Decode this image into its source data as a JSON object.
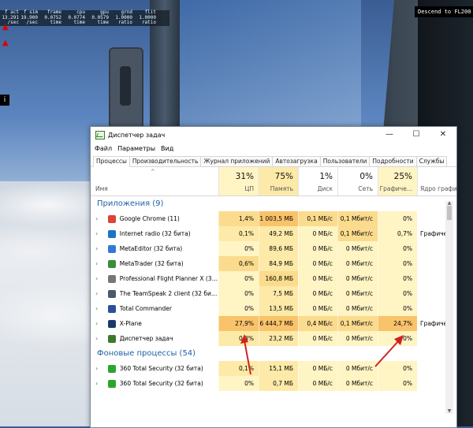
{
  "overlay": {
    "stats": [
      {
        "v1": "f act",
        "v2": "13.291",
        "v3": "/sec"
      },
      {
        "v1": "f sim",
        "v2": "19.900",
        "v3": "/sec"
      },
      {
        "v1": "frame",
        "v2": "0.0752",
        "v3": "time"
      },
      {
        "v1": "cpu",
        "v2": "0.0774",
        "v3": "time"
      },
      {
        "v1": "gpu",
        "v2": "0.0579",
        "v3": "time"
      },
      {
        "v1": "grnd",
        "v2": "1.0000",
        "v3": "ratio"
      },
      {
        "v1": "flit",
        "v2": "1.0000",
        "v3": "ratio"
      }
    ],
    "descent_message": "Descend to FL200",
    "fr_badge": "i"
  },
  "window": {
    "title": "Диспетчер задач",
    "controls": {
      "minimize": "—",
      "maximize": "☐",
      "close": "✕"
    }
  },
  "menu": [
    "Файл",
    "Параметры",
    "Вид"
  ],
  "tabs": [
    "Процессы",
    "Производительность",
    "Журнал приложений",
    "Автозагрузка",
    "Пользователи",
    "Подробности",
    "Службы"
  ],
  "header": {
    "name": "Имя",
    "sort_arrow": "^",
    "cpu": {
      "pct": "31%",
      "label": "ЦП"
    },
    "mem": {
      "pct": "75%",
      "label": "Память"
    },
    "disk": {
      "pct": "1%",
      "label": "Диск"
    },
    "net": {
      "pct": "0%",
      "label": "Сеть"
    },
    "gpu": {
      "pct": "25%",
      "label": "Графиче..."
    },
    "engine": {
      "label": "Ядро графи"
    }
  },
  "groups": {
    "apps": "Приложения (9)",
    "background": "Фоновые процессы (54)"
  },
  "rows": [
    {
      "name": "Google Chrome (11)",
      "cpu": "1,4%",
      "mem": "1 003,5 МБ",
      "disk": "0,1 МБ/с",
      "net": "0,1 Мбит/с",
      "gpu": "0%",
      "engine": "",
      "icon": "chrome-icon",
      "color": "#db4437"
    },
    {
      "name": "Internet radio (32 бита)",
      "cpu": "0,1%",
      "mem": "49,2 МБ",
      "disk": "0 МБ/с",
      "net": "0,1 Мбит/с",
      "gpu": "0,7%",
      "engine": "Графиче",
      "icon": "radio-icon",
      "color": "#1a73c8"
    },
    {
      "name": "MetaEditor (32 бита)",
      "cpu": "0%",
      "mem": "89,6 МБ",
      "disk": "0 МБ/с",
      "net": "0 Мбит/с",
      "gpu": "0%",
      "engine": "",
      "icon": "metaeditor-icon",
      "color": "#2e7bd6"
    },
    {
      "name": "MetaTrader (32 бита)",
      "cpu": "0,6%",
      "mem": "84,9 МБ",
      "disk": "0 МБ/с",
      "net": "0 Мбит/с",
      "gpu": "0%",
      "engine": "",
      "icon": "metatrader-icon",
      "color": "#3b8c3b"
    },
    {
      "name": "Professional Flight Planner X (32...",
      "cpu": "0%",
      "mem": "160,8 МБ",
      "disk": "0 МБ/с",
      "net": "0 Мбит/с",
      "gpu": "0%",
      "engine": "",
      "icon": "globe-icon",
      "color": "#777777"
    },
    {
      "name": "The TeamSpeak 2 client (32 бит...",
      "cpu": "0%",
      "mem": "7,5 МБ",
      "disk": "0 МБ/с",
      "net": "0 Мбит/с",
      "gpu": "0%",
      "engine": "",
      "icon": "teamspeak-icon",
      "color": "#4a5a6a"
    },
    {
      "name": "Total Commander",
      "cpu": "0%",
      "mem": "13,5 МБ",
      "disk": "0 МБ/с",
      "net": "0 Мбит/с",
      "gpu": "0%",
      "engine": "",
      "icon": "floppy-icon",
      "color": "#2d4f9a"
    },
    {
      "name": "X-Plane",
      "cpu": "27,9%",
      "mem": "6 444,7 МБ",
      "disk": "0,4 МБ/с",
      "net": "0,1 Мбит/с",
      "gpu": "24,7%",
      "engine": "Графиче",
      "icon": "xplane-icon",
      "color": "#1b3a6b"
    },
    {
      "name": "Диспетчер задач",
      "cpu": "0,3%",
      "mem": "23,2 МБ",
      "disk": "0 МБ/с",
      "net": "0 Мбит/с",
      "gpu": "0%",
      "engine": "",
      "icon": "taskmgr-icon",
      "color": "#3b7a2a"
    }
  ],
  "bg_rows": [
    {
      "name": "360 Total Security (32 бита)",
      "cpu": "0,1%",
      "mem": "15,1 МБ",
      "disk": "0 МБ/с",
      "net": "0 Мбит/с",
      "gpu": "0%",
      "engine": "",
      "icon": "shield-icon",
      "color": "#2aa62a"
    },
    {
      "name": "360 Total Security (32 бита)",
      "cpu": "0%",
      "mem": "0,7 МБ",
      "disk": "0 МБ/с",
      "net": "0 Мбит/с",
      "gpu": "0%",
      "engine": "",
      "icon": "shield-icon",
      "color": "#2aa62a"
    }
  ],
  "colors": {
    "group": "#1f5fa8",
    "highlight": "#fbdb8d",
    "strong": "#f9c36b",
    "arrow": "#d22020"
  }
}
